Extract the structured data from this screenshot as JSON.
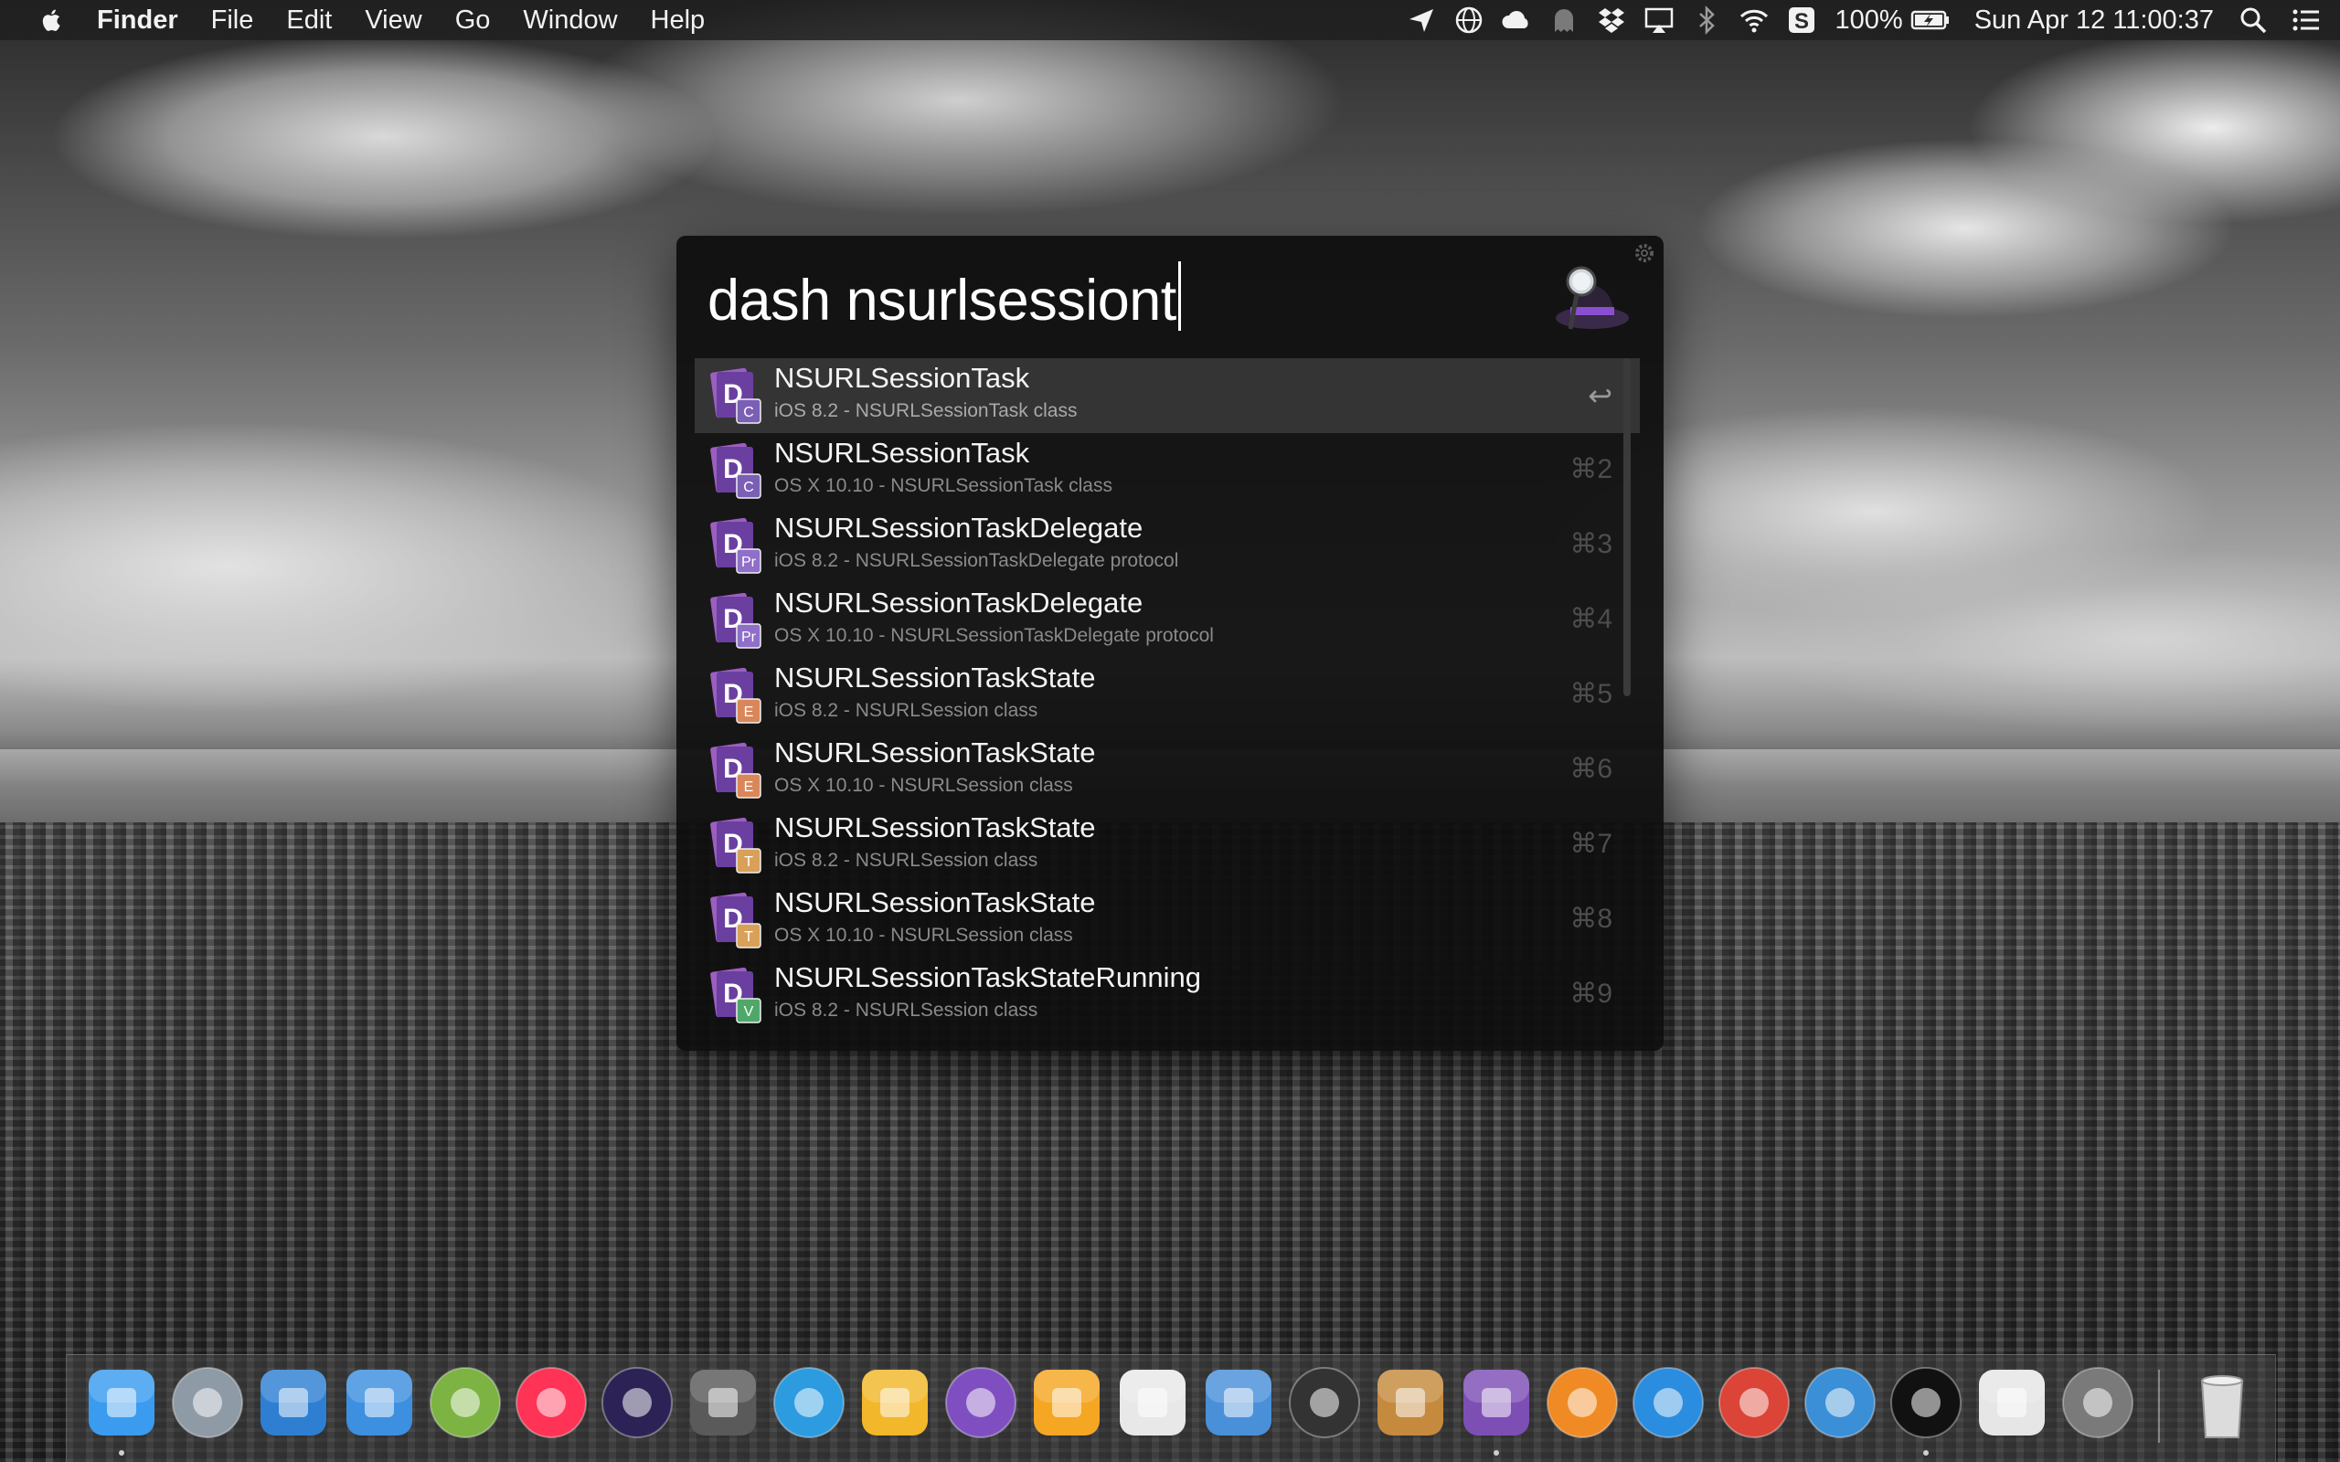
{
  "menubar": {
    "app_name": "Finder",
    "menus": [
      "File",
      "Edit",
      "View",
      "Go",
      "Window",
      "Help"
    ],
    "battery": "100%",
    "clock": "Sun Apr 12  11:00:37",
    "status_icons": [
      "location-arrow-icon",
      "globe-icon",
      "cloud-icon",
      "ghost-icon",
      "dropbox-icon",
      "airplay-icon",
      "bluetooth-icon",
      "wifi-icon",
      "s-app-icon",
      "battery-icon",
      "spotlight-search-icon",
      "notification-center-icon"
    ]
  },
  "alfred": {
    "query": "dash nsurlsessiont",
    "results": [
      {
        "title": "NSURLSessionTask",
        "subtitle": "iOS 8.2 - NSURLSessionTask class",
        "shortcut": "↩",
        "badge": "C",
        "badge_color": "#7b5fb5",
        "selected": true
      },
      {
        "title": "NSURLSessionTask",
        "subtitle": "OS X 10.10 - NSURLSessionTask class",
        "shortcut": "⌘2",
        "badge": "C",
        "badge_color": "#7b5fb5"
      },
      {
        "title": "NSURLSessionTaskDelegate",
        "subtitle": "iOS 8.2 - NSURLSessionTaskDelegate protocol",
        "shortcut": "⌘3",
        "badge": "Pr",
        "badge_color": "#8f6fc9"
      },
      {
        "title": "NSURLSessionTaskDelegate",
        "subtitle": "OS X 10.10 - NSURLSessionTaskDelegate protocol",
        "shortcut": "⌘4",
        "badge": "Pr",
        "badge_color": "#8f6fc9"
      },
      {
        "title": "NSURLSessionTaskState",
        "subtitle": "iOS 8.2 - NSURLSession class",
        "shortcut": "⌘5",
        "badge": "E",
        "badge_color": "#d9875a"
      },
      {
        "title": "NSURLSessionTaskState",
        "subtitle": "OS X 10.10 - NSURLSession class",
        "shortcut": "⌘6",
        "badge": "E",
        "badge_color": "#d9875a"
      },
      {
        "title": "NSURLSessionTaskState",
        "subtitle": "iOS 8.2 - NSURLSession class",
        "shortcut": "⌘7",
        "badge": "T",
        "badge_color": "#d9a05a"
      },
      {
        "title": "NSURLSessionTaskState",
        "subtitle": "OS X 10.10 - NSURLSession class",
        "shortcut": "⌘8",
        "badge": "T",
        "badge_color": "#d9a05a"
      },
      {
        "title": "NSURLSessionTaskStateRunning",
        "subtitle": "iOS 8.2 - NSURLSession class",
        "shortcut": "⌘9",
        "badge": "V",
        "badge_color": "#4fa86a"
      }
    ]
  },
  "dock": {
    "apps": [
      {
        "name": "finder",
        "color": "#3a9bef",
        "running": true
      },
      {
        "name": "launchpad",
        "color": "#8e9aa6"
      },
      {
        "name": "xcode",
        "color": "#2e7fd1"
      },
      {
        "name": "ios-simulator",
        "color": "#3d8fe0"
      },
      {
        "name": "android-studio",
        "color": "#7cb342"
      },
      {
        "name": "flickr-app",
        "color": "#ff3355"
      },
      {
        "name": "eclipse",
        "color": "#2c2255"
      },
      {
        "name": "sublime-text",
        "color": "#5a5a5a"
      },
      {
        "name": "markdown-app",
        "color": "#2c9be0"
      },
      {
        "name": "cloud-sync-app",
        "color": "#f2b72a"
      },
      {
        "name": "github-desktop",
        "color": "#7f4fc2"
      },
      {
        "name": "sketch",
        "color": "#f5a623"
      },
      {
        "name": "pinwheel-app",
        "color": "#e8e8e8"
      },
      {
        "name": "preview-app",
        "color": "#4a90d9"
      },
      {
        "name": "digital-color-meter",
        "color": "#333333"
      },
      {
        "name": "archive-app",
        "color": "#c58a3e"
      },
      {
        "name": "dash",
        "color": "#7d4fb5",
        "running": true
      },
      {
        "name": "ibooks",
        "color": "#f08a24"
      },
      {
        "name": "safari",
        "color": "#2a8de0"
      },
      {
        "name": "chrome",
        "color": "#db4437"
      },
      {
        "name": "weibo",
        "color": "#3b8fd6"
      },
      {
        "name": "qq",
        "color": "#111111",
        "running": true
      },
      {
        "name": "aaa-app",
        "color": "#e6e6e6"
      },
      {
        "name": "system-preferences",
        "color": "#7a7a7a"
      },
      {
        "name": "trash",
        "color": "#dcdcdc"
      }
    ]
  }
}
